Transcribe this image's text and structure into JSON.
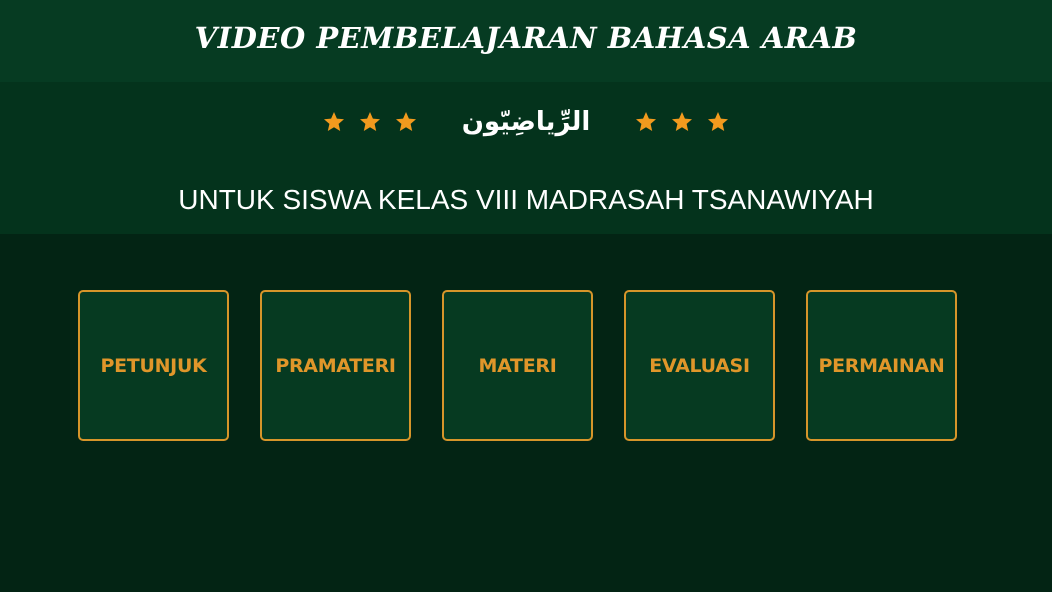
{
  "header": {
    "title": "VIDEO PEMBELAJARAN BAHASA ARAB",
    "arabic_title": "الرِّياضِيّون",
    "tagline": "UNTUK SISWA KELAS VIII MADRASAH TSANAWIYAH",
    "star_count_each_side": 3
  },
  "menu": {
    "items": [
      {
        "label": "PETUNJUK"
      },
      {
        "label": "PRAMATERI"
      },
      {
        "label": "MATERI"
      },
      {
        "label": "EVALUASI"
      },
      {
        "label": "PERMAINAN"
      }
    ]
  },
  "colors": {
    "background": "#032414",
    "header": "#04331c",
    "accent": "#e0962a",
    "text": "#ffffff"
  }
}
